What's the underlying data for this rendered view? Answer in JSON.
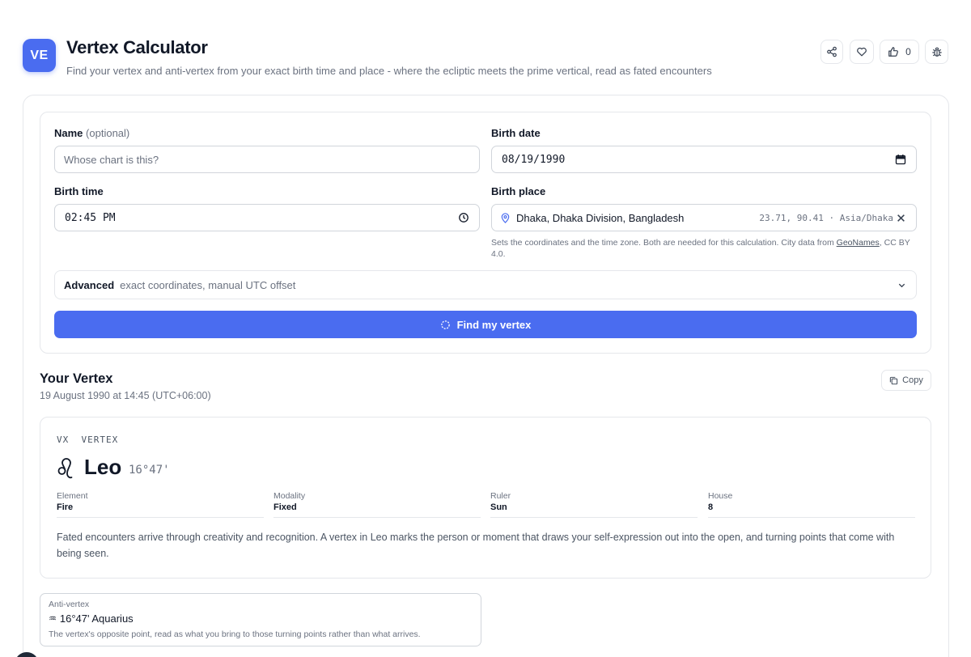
{
  "header": {
    "logo_text": "VE",
    "title": "Vertex Calculator",
    "subtitle": "Find your vertex and anti-vertex from your exact birth time and place - where the ecliptic meets the prime vertical, read as fated encounters",
    "like_count": "0",
    "accent_color": "#4a6cf0",
    "icons": [
      "share-icon",
      "heart-icon",
      "thumbs-up-icon",
      "bug-icon"
    ]
  },
  "form": {
    "name_label": "Name",
    "name_optional": "(optional)",
    "name_placeholder": "Whose chart is this?",
    "birth_date_label": "Birth date",
    "birth_date_value": "08/19/1990",
    "birth_time_label": "Birth time",
    "birth_time_value": "02:45 PM",
    "birth_place_label": "Birth place",
    "birth_place_value": "Dhaka, Dhaka Division, Bangladesh",
    "birth_place_meta": "23.71, 90.41 · Asia/Dhaka",
    "hint_text": "Sets the coordinates and the time zone. Both are needed for this calculation. City data from",
    "hint_link": "GeoNames",
    "hint_suffix": ", CC BY 4.0.",
    "advanced_title": "Advanced",
    "advanced_desc": "exact coordinates, manual UTC offset",
    "submit_label": "Find my vertex"
  },
  "result": {
    "title": "Your Vertex",
    "date": "19 August 1990",
    "time_text": "at 14:45 (UTC+06:00)",
    "copy_label": "Copy",
    "vx_abbr": "VX",
    "vx_label": "VERTEX",
    "sign": "Leo",
    "degree": "16°47'",
    "sign_icon": "leo-icon",
    "attributes": [
      {
        "label": "Element",
        "value": "Fire"
      },
      {
        "label": "Modality",
        "value": "Fixed"
      },
      {
        "label": "Ruler",
        "value": "Sun"
      },
      {
        "label": "House",
        "value": "8"
      }
    ],
    "description": "Fated encounters arrive through creativity and recognition. A vertex in Leo marks the person or moment that draws your self-expression out into the open, and turning points that come with being seen."
  },
  "anti_vertex": {
    "label": "Anti-vertex",
    "glyph": "♒",
    "value": "16°47' Aquarius",
    "note": "The vertex's opposite point, read as what you bring to those turning points rather than what arrives."
  }
}
